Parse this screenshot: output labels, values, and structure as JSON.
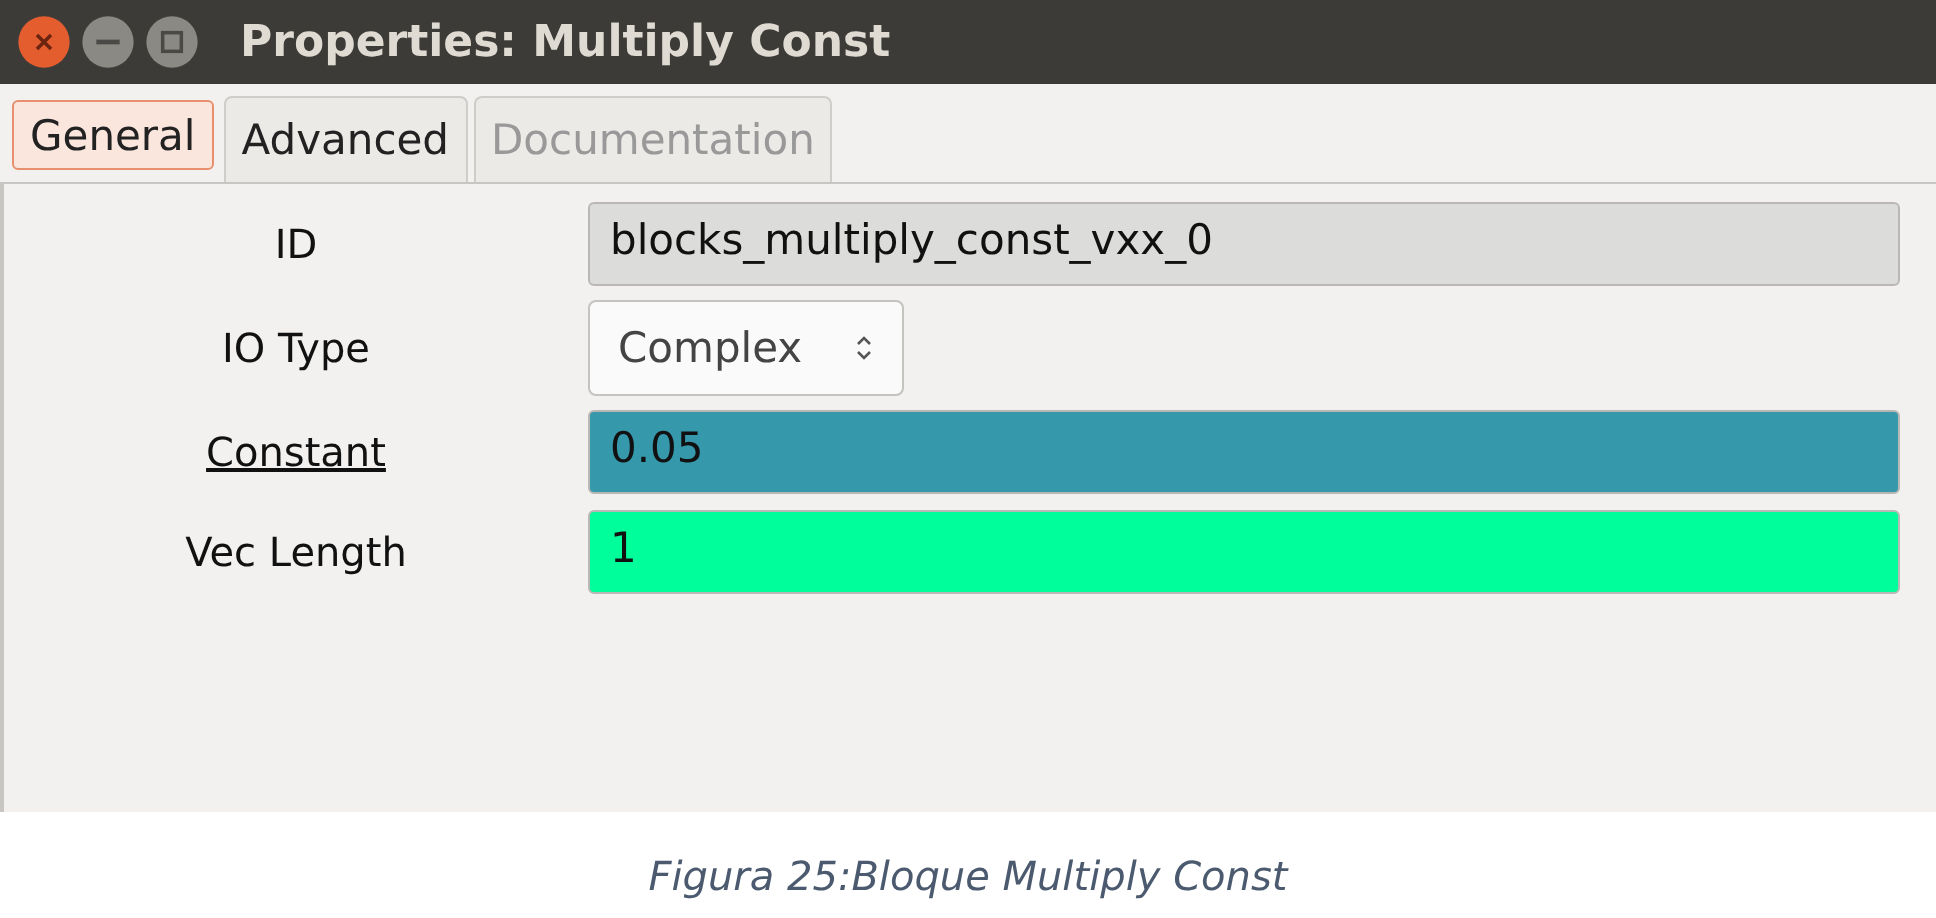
{
  "window": {
    "title": "Properties: Multiply Const"
  },
  "tabs": [
    {
      "label": "General",
      "selected": true,
      "disabled": false
    },
    {
      "label": "Advanced",
      "selected": false,
      "disabled": false
    },
    {
      "label": "Documentation",
      "selected": false,
      "disabled": true
    }
  ],
  "params": [
    {
      "label": "ID",
      "kind": "readonly",
      "value": "blocks_multiply_const_vxx_0",
      "underlined": false
    },
    {
      "label": "IO Type",
      "kind": "dropdown",
      "value": "Complex",
      "underlined": false
    },
    {
      "label": "Constant",
      "kind": "entry",
      "value": "0.05",
      "color": "#3598ab",
      "underlined": true
    },
    {
      "label": "Vec Length",
      "kind": "entry",
      "value": "1",
      "color": "#00fe9b",
      "underlined": false
    }
  ],
  "caption": "Figura 25:Bloque Multiply Const"
}
